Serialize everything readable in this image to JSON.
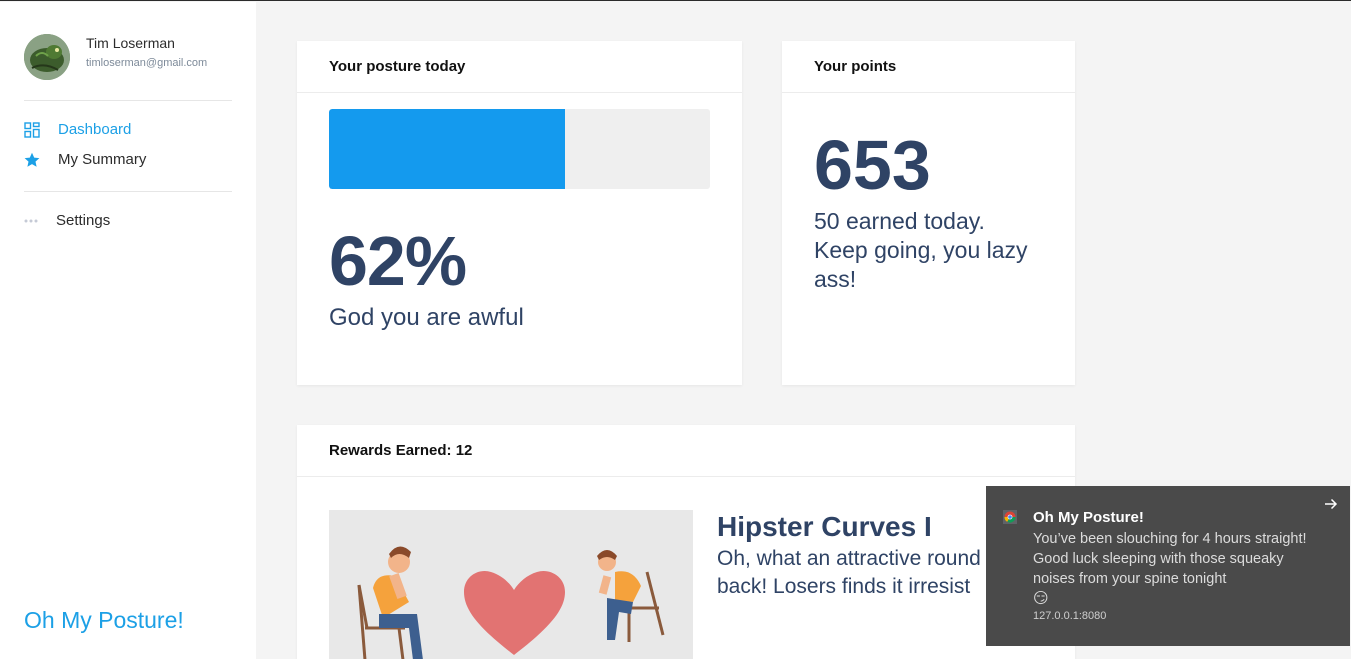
{
  "sidebar": {
    "user": {
      "name": "Tim Loserman",
      "email": "timloserman@gmail.com"
    },
    "nav": [
      {
        "label": "Dashboard",
        "icon": "grid-icon",
        "active": true
      },
      {
        "label": "My Summary",
        "icon": "star-icon",
        "active": false
      }
    ],
    "settings": {
      "label": "Settings",
      "icon": "more-dots-icon"
    },
    "brand": "Oh My Posture!"
  },
  "posture": {
    "header": "Your posture today",
    "percent_text": "62%",
    "level": 0.62,
    "message": "God you are awful"
  },
  "points": {
    "header": "Your points",
    "value": "653",
    "line1": "50 earned today.",
    "line2": "Keep going, you lazy ass!"
  },
  "rewards": {
    "header": "Rewards Earned: 12",
    "item": {
      "title": "Hipster Curves I",
      "description_line1": "Oh, what an attractive round",
      "description_line2": "back! Losers finds it irresist"
    }
  },
  "toast": {
    "title": "Oh My Posture!",
    "body": "You’ve been slouching for 4 hours straight! Good luck sleeping with those squeaky noises from your spine tonight",
    "emoji": "😏",
    "source": "127.0.0.1:8080"
  },
  "colors": {
    "accent": "#1ca0e6",
    "bar": "#149aee",
    "text_dark": "#2f4365",
    "heart": "#e27372",
    "toast_bg": "#4a4a4a"
  }
}
